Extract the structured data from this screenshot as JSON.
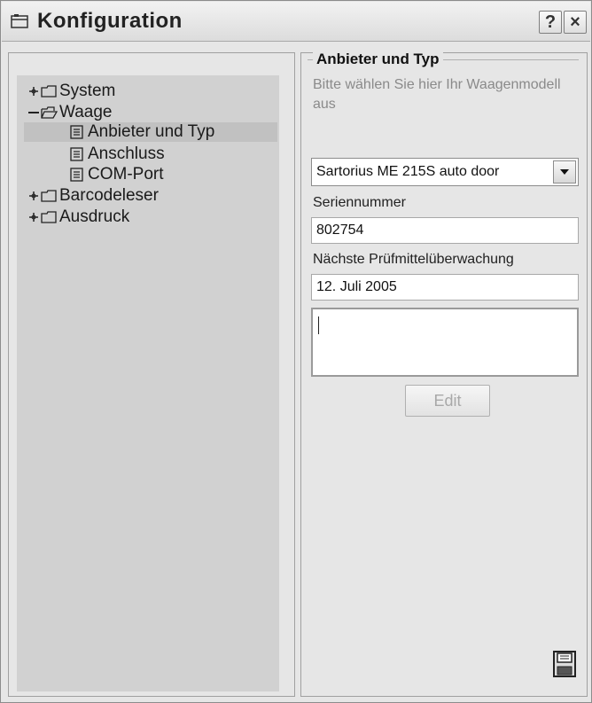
{
  "window": {
    "title": "Konfiguration",
    "help_label": "?",
    "close_label": "×"
  },
  "tree": {
    "items": [
      {
        "label": "System",
        "expander": "plus",
        "icon": "folder-icon"
      },
      {
        "label": "Waage",
        "expander": "minus",
        "icon": "folder-open-icon"
      },
      {
        "label": "Anbieter und Typ",
        "icon": "document-icon",
        "selected": true
      },
      {
        "label": "Anschluss",
        "icon": "document-icon"
      },
      {
        "label": "COM-Port",
        "icon": "document-icon"
      },
      {
        "label": "Barcodeleser",
        "expander": "plus",
        "icon": "folder-icon"
      },
      {
        "label": "Ausdruck",
        "expander": "plus",
        "icon": "folder-icon"
      }
    ]
  },
  "settings": {
    "group_title": "Anbieter und Typ",
    "description": "Bitte wählen Sie hier Ihr Waagenmodell aus",
    "model_select": {
      "value": "Sartorius ME 215S auto door"
    },
    "serial_label": "Seriennummer",
    "serial_value": "802754",
    "inspection_label": "Nächste Prüfmittelüberwachung",
    "inspection_value": "12. Juli 2005",
    "notes_value": "",
    "edit_label": "Edit"
  },
  "colors": {
    "background": "#e6e6e6",
    "tree_background": "#d1d1d1",
    "selected_row": "#c1c1c1",
    "disabled_text": "#a8a8a8"
  }
}
